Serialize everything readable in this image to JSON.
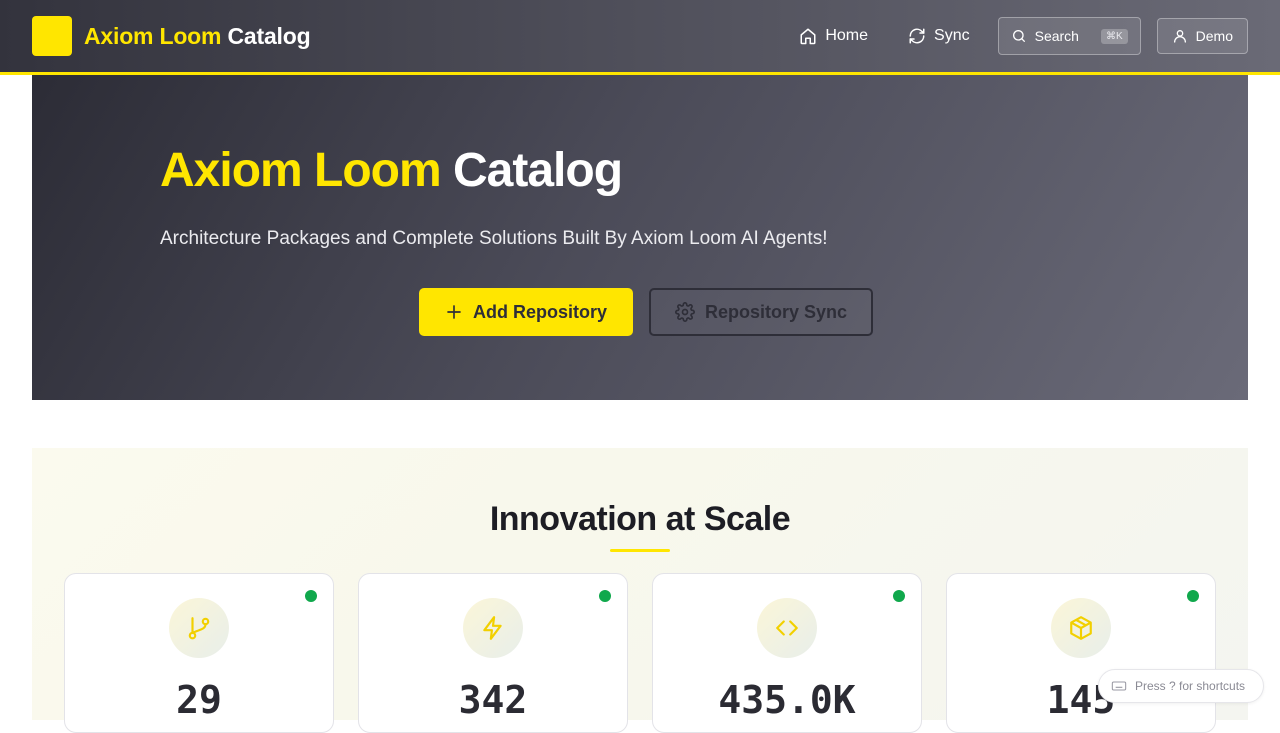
{
  "header": {
    "brand_part1": "Axiom Loom",
    "brand_part2": "Catalog",
    "nav": {
      "home": "Home",
      "sync": "Sync",
      "search": "Search",
      "search_shortcut": "⌘K",
      "user": "Demo"
    }
  },
  "hero": {
    "title_part1": "Axiom Loom",
    "title_part2": "Catalog",
    "subtitle": "Architecture Packages and Complete Solutions Built By Axiom Loom AI Agents!",
    "add_repo_label": "Add Repository",
    "repo_sync_label": "Repository Sync"
  },
  "stats": {
    "title": "Innovation at Scale",
    "cards": [
      {
        "icon": "git-branch-icon",
        "value": "29"
      },
      {
        "icon": "lightning-icon",
        "value": "342"
      },
      {
        "icon": "code-icon",
        "value": "435.0K"
      },
      {
        "icon": "package-icon",
        "value": "145"
      }
    ]
  },
  "shortcut_hint": "Press ? for shortcuts",
  "colors": {
    "accent": "#ffe600",
    "header_dark": "#33333d",
    "status_green": "#10a84c"
  }
}
